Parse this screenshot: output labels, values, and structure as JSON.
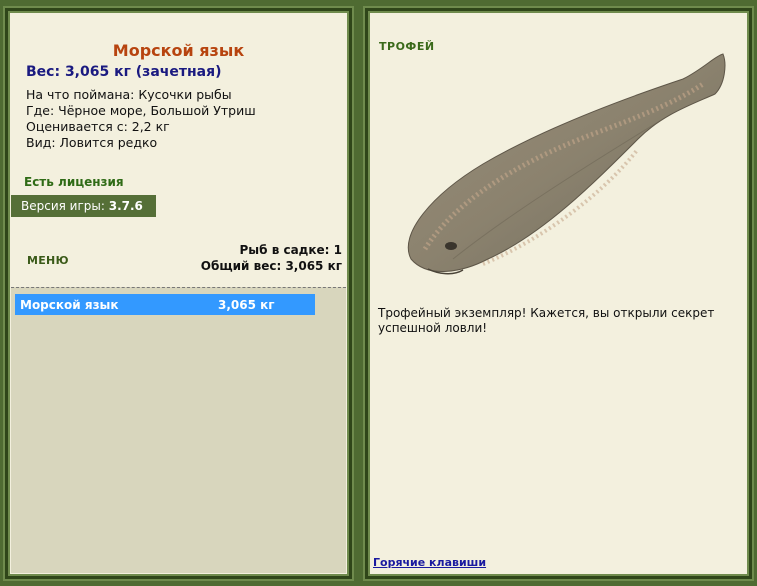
{
  "left": {
    "fish_name": "Морской язык",
    "weight": "Вес: 3,065 кг (зачетная)",
    "bait": "На что поймана: Кусочки рыбы",
    "location": "Где: Чёрное море, Большой Утриш",
    "rated_from": "Оценивается с: 2,2 кг",
    "type": "Вид: Ловится редко",
    "license": "Есть лицензия",
    "version_label": "Версия игры:",
    "version_value": "3.7.6",
    "menu": "МЕНЮ",
    "fish_in_keepnet": "Рыб в садке: 1",
    "total_weight": "Общий вес: 3,065 кг"
  },
  "catch_list": [
    {
      "name": "Морской язык",
      "weight": "3,065 кг"
    }
  ],
  "right": {
    "heading": "ТРОФЕЙ",
    "message": "Трофейный экземпляр! Кажется, вы открыли секрет успешной ловли!",
    "hotkeys": "Горячие клавиши"
  },
  "colors": {
    "background": "#4f6b32",
    "panel": "#f3f0de",
    "title": "#b7440f",
    "highlight": "#3399ff"
  },
  "icons": {
    "fish_image": "flounder-fish-image"
  }
}
